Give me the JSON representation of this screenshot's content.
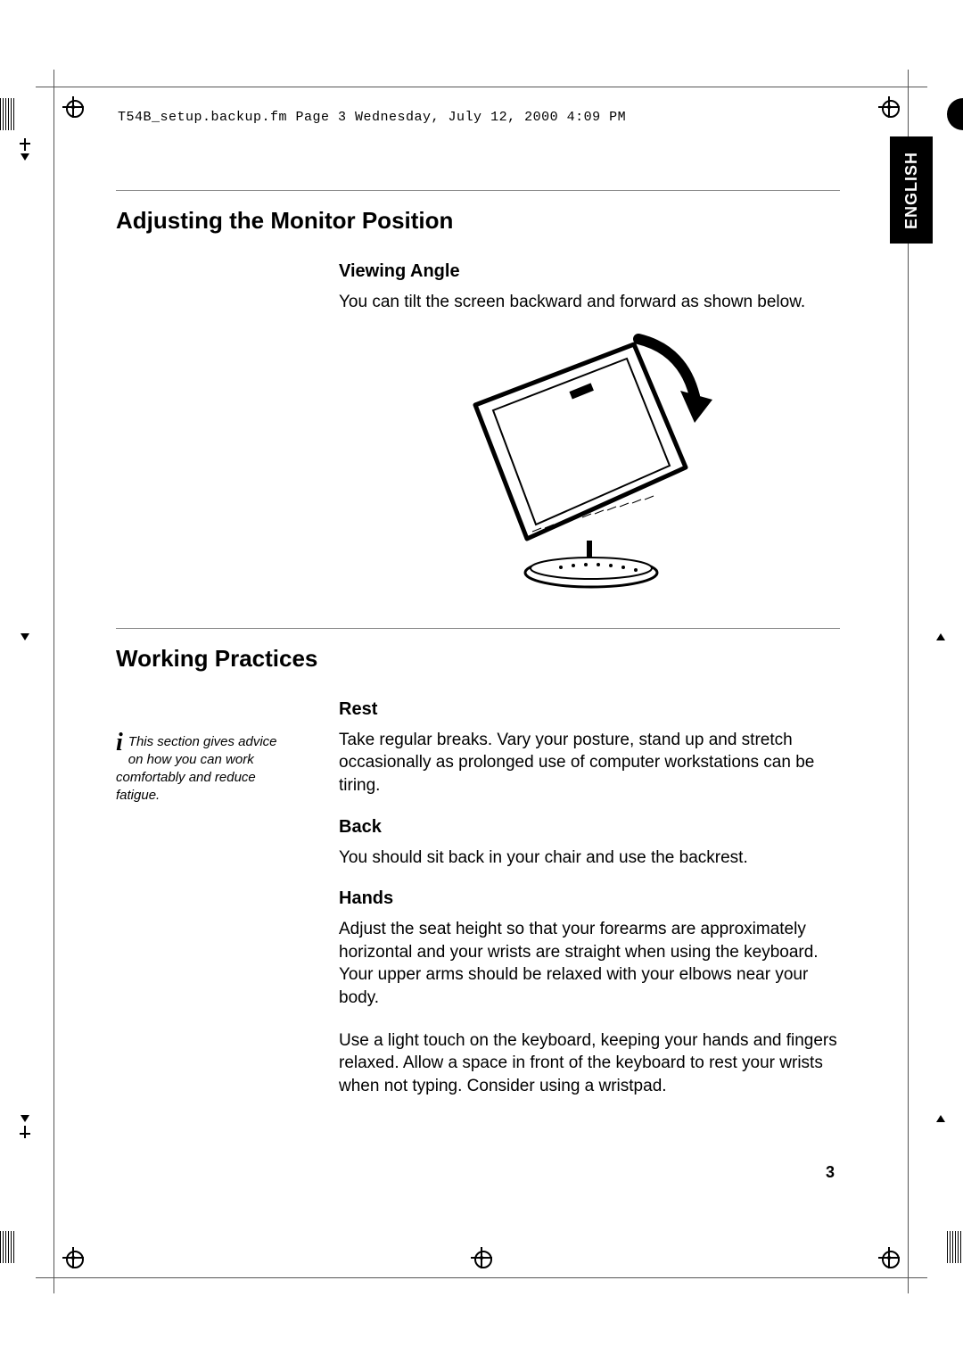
{
  "header_line": "T54B_setup.backup.fm   Page 3   Wednesday, July 12, 2000   4:09 PM",
  "language_tab": "ENGLISH",
  "section1": {
    "title": "Adjusting the Monitor Position",
    "sub1": {
      "heading": "Viewing Angle",
      "body": "You can tilt the screen backward and forward as shown below."
    }
  },
  "section2": {
    "title": "Working Practices",
    "sidenote": "This section gives advice on how you can work comfortably and reduce fatigue.",
    "sub1": {
      "heading": "Rest",
      "body": "Take regular breaks. Vary your posture, stand up and stretch occasionally as prolonged use of computer workstations can be tiring."
    },
    "sub2": {
      "heading": "Back",
      "body": "You should sit back in your chair and use the backrest."
    },
    "sub3": {
      "heading": "Hands",
      "body1": "Adjust the seat height so that your forearms are approximately horizontal and your wrists are straight when using the keyboard. Your upper arms should be relaxed with your elbows near your body.",
      "body2": "Use a light touch on the keyboard, keeping your hands and fingers relaxed. Allow a space in front of the keyboard to rest your wrists when not typing. Consider using a wristpad."
    }
  },
  "page_number": "3"
}
